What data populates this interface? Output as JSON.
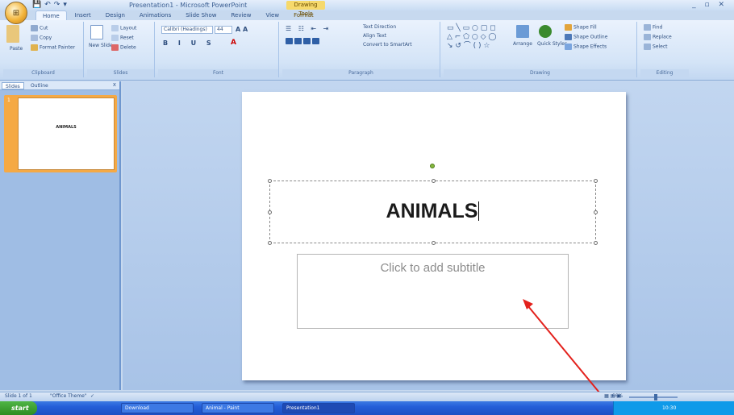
{
  "window": {
    "app_title": "Presentation1 - Microsoft PowerPoint",
    "context_tab": "Drawing Tools",
    "quick_access": [
      "💾",
      "↶",
      "↷",
      "▾"
    ]
  },
  "ribbon": {
    "tabs": [
      "Home",
      "Insert",
      "Design",
      "Animations",
      "Slide Show",
      "Review",
      "View",
      "Format"
    ],
    "active_tab": "Home",
    "clipboard": {
      "paste": "Paste",
      "cut": "Cut",
      "copy": "Copy",
      "format_painter": "Format Painter",
      "label": "Clipboard"
    },
    "slides": {
      "new_slide": "New Slide",
      "layout": "Layout",
      "reset": "Reset",
      "delete": "Delete",
      "label": "Slides"
    },
    "font": {
      "font_name": "Calibri (Headings)",
      "font_size": "44",
      "label": "Font"
    },
    "paragraph": {
      "text_direction": "Text Direction",
      "align_text": "Align Text",
      "convert_smartart": "Convert to SmartArt",
      "label": "Paragraph"
    },
    "drawing": {
      "arrange": "Arrange",
      "quick_styles": "Quick Styles",
      "shape_fill": "Shape Fill",
      "shape_outline": "Shape Outline",
      "shape_effects": "Shape Effects",
      "label": "Drawing"
    },
    "editing": {
      "find": "Find",
      "replace": "Replace",
      "select": "Select",
      "label": "Editing"
    }
  },
  "left_pane": {
    "tabs": [
      "Slides",
      "Outline"
    ],
    "close": "x",
    "slide_number": "1",
    "thumbnail_title": "ANIMALS"
  },
  "slide": {
    "title": "ANIMALS",
    "subtitle_placeholder": "Click to add subtitle"
  },
  "status": {
    "slide_info": "Slide 1 of 1",
    "theme": "\"Office Theme\"",
    "zoom": "66%"
  },
  "taskbar": {
    "start": "start",
    "items": [
      "Download",
      "Animal - Paint",
      "Presentation1"
    ],
    "clock": "10:30"
  }
}
